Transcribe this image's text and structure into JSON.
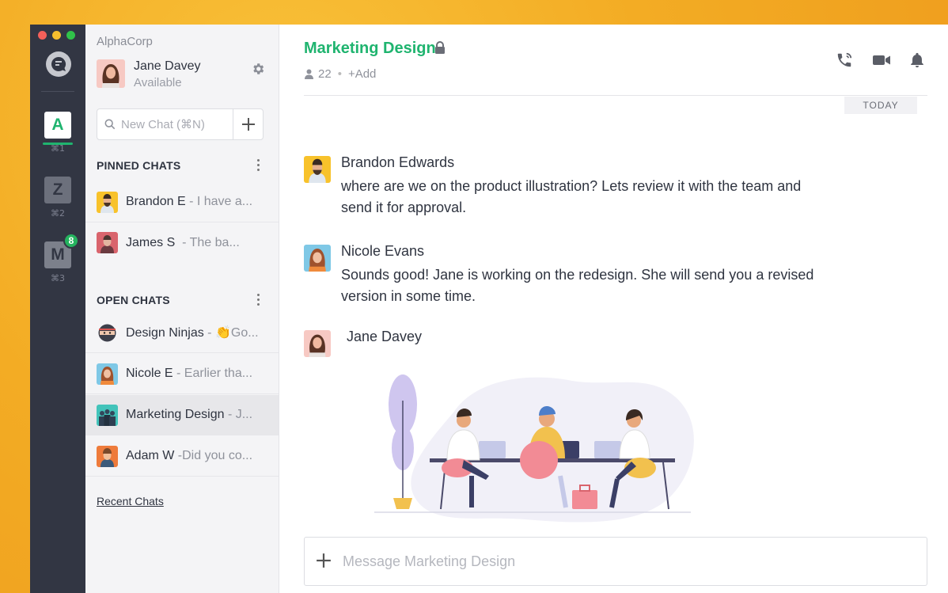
{
  "colors": {
    "accent_green": "#1fb46f",
    "rail_bg": "#323643",
    "traffic_red": "#f4605a",
    "traffic_yellow": "#f5be2e",
    "traffic_green": "#30c24a",
    "workspace_z": "#6c707c",
    "workspace_m": "#7c808b"
  },
  "rail": {
    "workspaces": [
      {
        "letter": "A",
        "shortcut": "⌘1",
        "active": true
      },
      {
        "letter": "Z",
        "shortcut": "⌘2"
      },
      {
        "letter": "M",
        "shortcut": "⌘3",
        "badge": "8"
      }
    ]
  },
  "sidebar": {
    "org_name": "AlphaCorp",
    "user": {
      "name": "Jane Davey",
      "status": "Available"
    },
    "search": {
      "placeholder": "New Chat (⌘N)",
      "add_icon": "plus-icon"
    },
    "pinned": {
      "heading": "PINNED CHATS",
      "items": [
        {
          "name": "Brandon E",
          "preview": "- I have a..."
        },
        {
          "name": "James S",
          "preview": "- The ba..."
        }
      ]
    },
    "open": {
      "heading": "OPEN CHATS",
      "items": [
        {
          "name": "Design Ninjas",
          "preview": "- 👏Go..."
        },
        {
          "name": "Nicole E",
          "preview": "- Earlier tha..."
        },
        {
          "name": "Marketing Design",
          "preview": "- J..."
        },
        {
          "name": "Adam W",
          "preview": "-Did you co..."
        }
      ]
    },
    "recent_link": "Recent Chats"
  },
  "main": {
    "title": "Marketing Design",
    "member_count": "22",
    "add_label": "+Add",
    "date_divider": "TODAY",
    "messages": [
      {
        "author": "Brandon Edwards",
        "text": "where are we on the product illustration? Lets review it with the team and send it for approval."
      },
      {
        "author": "Nicole Evans",
        "text": "Sounds good! Jane is working on the redesign. She will send you a revised version in some time."
      },
      {
        "author": "Jane Davey",
        "attachment": "team-illustration"
      }
    ],
    "composer_placeholder": "Message Marketing Design"
  }
}
